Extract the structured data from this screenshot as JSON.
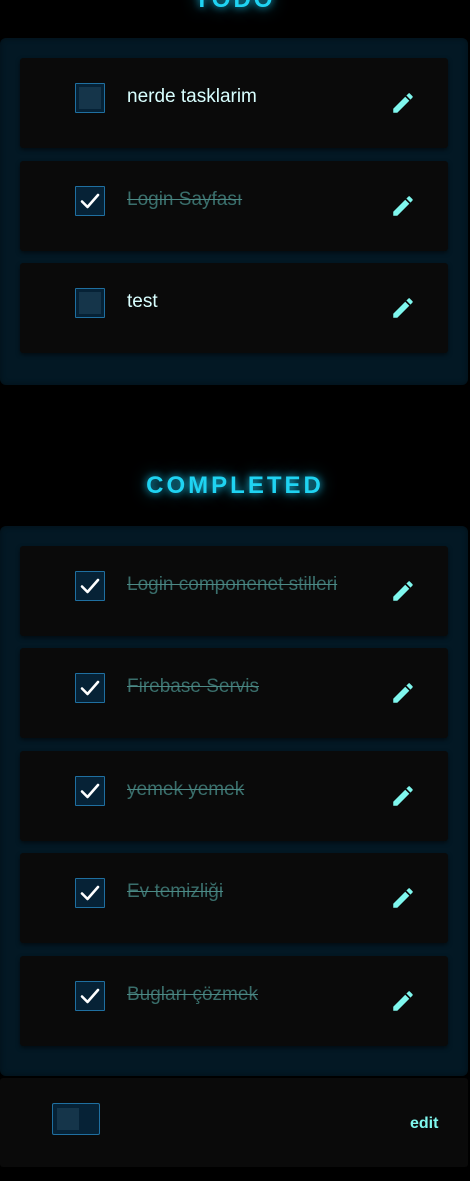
{
  "sections": {
    "todo_title": "TODO",
    "completed_title": "COMPLETED"
  },
  "todo": [
    {
      "label": "nerde tasklarim",
      "checked": false
    },
    {
      "label": "Login Sayfası",
      "checked": true
    },
    {
      "label": "test",
      "checked": false
    }
  ],
  "completed": [
    {
      "label": "Login componenet stilleri",
      "checked": true
    },
    {
      "label": "Firebase Servis",
      "checked": true
    },
    {
      "label": "yemek yemek",
      "checked": true
    },
    {
      "label": "Ev temizliği",
      "checked": true
    },
    {
      "label": "Bugları çözmek",
      "checked": true
    }
  ],
  "footer": {
    "toggle_on": false,
    "edit_label": "edit"
  },
  "icons": {
    "edit": "pencil-icon",
    "check": "checkmark-icon"
  },
  "colors": {
    "accent": "#1fd3f2",
    "pencil": "#7ff7ee",
    "done_text": "#3a6f6c",
    "active_text": "#d9ffff",
    "panel": "#031824",
    "card": "#0a0a0a"
  }
}
